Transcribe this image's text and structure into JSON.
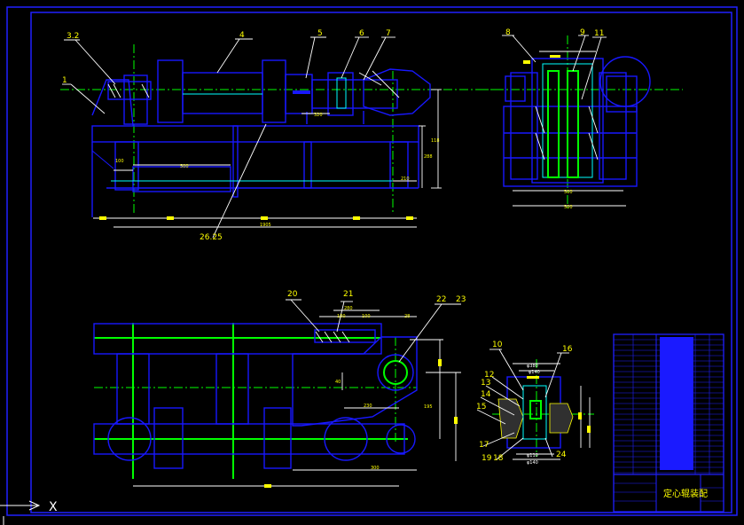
{
  "title_block": {
    "name": "定心辊装配"
  },
  "parts": {
    "p1": "1",
    "p2_3": "3.2",
    "p4": "4",
    "p5": "5",
    "p6": "6",
    "p7": "7",
    "p8": "8",
    "p9": "9",
    "p11": "11",
    "p10": "10",
    "p12": "12",
    "p13": "13",
    "p14": "14",
    "p15": "15",
    "p16": "16",
    "p17": "17",
    "p18": "18",
    "p19": "19",
    "p20": "20",
    "p21": "21",
    "p22": "22",
    "p23": "23",
    "p24": "24",
    "p25_26": "26.25"
  },
  "dims": {
    "d100a": "100",
    "d500": "500",
    "d320": "320",
    "d210": "210",
    "d120": "120",
    "d1905": "1905",
    "d118": "118",
    "d288": "288",
    "d500b": "500",
    "d500c": "500",
    "d280": "280",
    "d100b": "100",
    "d100c": "100",
    "d28": "28",
    "d40": "40",
    "d230": "230",
    "d195": "195",
    "d300": "300",
    "d380": "φ380",
    "d140": "φ140",
    "d110": "φ110",
    "d140b": "φ140"
  },
  "ucs": {
    "axis_label": "X"
  }
}
